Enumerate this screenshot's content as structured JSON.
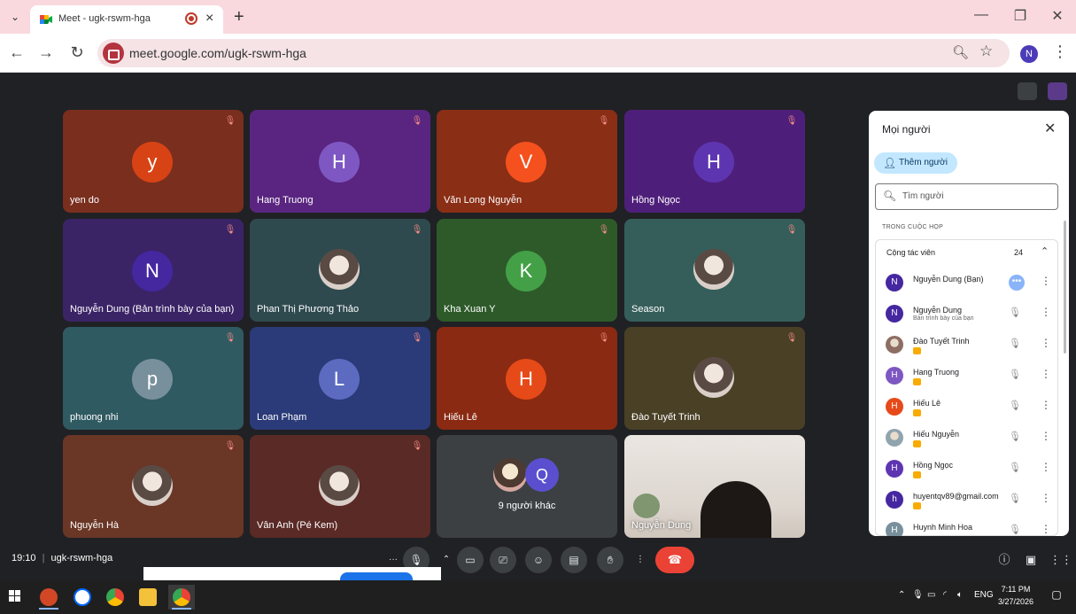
{
  "browser": {
    "tab_title": "Meet - ugk-rswm-hga",
    "new_tab_symbol": "+",
    "url": "meet.google.com/ugk-rswm-hga",
    "profile_initial": "N"
  },
  "tiles": [
    {
      "name": "yen do",
      "initial": "y",
      "avatar_color": "#d84315",
      "bg": "#7a2e1e",
      "photo": false
    },
    {
      "name": "Hang Truong",
      "initial": "H",
      "avatar_color": "#7e57c2",
      "bg": "#5a2580",
      "photo": false
    },
    {
      "name": "Văn Long Nguyễn",
      "initial": "V",
      "avatar_color": "#f4511e",
      "bg": "#8a2e16",
      "photo": false
    },
    {
      "name": "Hồng Ngọc",
      "initial": "H",
      "avatar_color": "#5e35b1",
      "bg": "#4e1f7a",
      "photo": false
    },
    {
      "name": "Nguyễn Dung (Bản trình bày của bạn)",
      "initial": "N",
      "avatar_color": "#4527a0",
      "bg": "#3a2466",
      "photo": false
    },
    {
      "name": "Phan Thị Phương Thảo",
      "initial": "",
      "avatar_color": "",
      "bg": "#2f4a4f",
      "photo": true
    },
    {
      "name": "Kha Xuan Y",
      "initial": "K",
      "avatar_color": "#43a047",
      "bg": "#2e5a2a",
      "photo": false
    },
    {
      "name": "Season",
      "initial": "",
      "avatar_color": "",
      "bg": "#355e5a",
      "photo": true
    },
    {
      "name": "phuong nhi",
      "initial": "p",
      "avatar_color": "#78909c",
      "bg": "#305a62",
      "photo": false
    },
    {
      "name": "Loan Phạm",
      "initial": "L",
      "avatar_color": "#5c6bc0",
      "bg": "#2b3a78",
      "photo": false
    },
    {
      "name": "Hiếu Lê",
      "initial": "H",
      "avatar_color": "#e64a19",
      "bg": "#8a2a12",
      "photo": false
    },
    {
      "name": "Đào Tuyết Trinh",
      "initial": "",
      "avatar_color": "",
      "bg": "#4a4026",
      "photo": true
    },
    {
      "name": "Nguyễn Hà",
      "initial": "",
      "avatar_color": "",
      "bg": "#6a3626",
      "photo": true
    },
    {
      "name": "Vân Anh (Pé Kem)",
      "initial": "",
      "avatar_color": "",
      "bg": "#5a2a26",
      "photo": true
    }
  ],
  "others_tile": {
    "initial": "Q",
    "label": "9 người khác"
  },
  "self_tile": {
    "name": "Nguyễn Dung"
  },
  "panel": {
    "title": "Mọi người",
    "add_label": "Thêm người",
    "search_placeholder": "Tìm người",
    "section_label": "TRONG CUỘC HỌP",
    "group_name": "Cộng tác viên",
    "group_count": "24",
    "members": [
      {
        "name": "Nguyễn Dung (Bạn)",
        "sub": "",
        "initial": "N",
        "color": "#4527a0",
        "photo": false,
        "badge": false,
        "action": "more"
      },
      {
        "name": "Nguyễn Dung",
        "sub": "Bản trình bày của bạn",
        "initial": "N",
        "color": "#4527a0",
        "photo": false,
        "badge": false,
        "action": "mute"
      },
      {
        "name": "Đào Tuyết Trinh",
        "sub": "",
        "initial": "",
        "color": "#8d6e63",
        "photo": true,
        "badge": true,
        "action": "mute"
      },
      {
        "name": "Hang Truong",
        "sub": "",
        "initial": "H",
        "color": "#7e57c2",
        "photo": false,
        "badge": true,
        "action": "mute"
      },
      {
        "name": "Hiếu Lê",
        "sub": "",
        "initial": "H",
        "color": "#e64a19",
        "photo": false,
        "badge": true,
        "action": "mute"
      },
      {
        "name": "Hiếu Nguyễn",
        "sub": "",
        "initial": "",
        "color": "#90a4ae",
        "photo": true,
        "badge": true,
        "action": "mute"
      },
      {
        "name": "Hồng Ngọc",
        "sub": "",
        "initial": "H",
        "color": "#5e35b1",
        "photo": false,
        "badge": true,
        "action": "mute"
      },
      {
        "name": "huyentqv89@gmail.com",
        "sub": "",
        "initial": "h",
        "color": "#4527a0",
        "photo": false,
        "badge": true,
        "action": "mute"
      },
      {
        "name": "Huynh Minh Hoa",
        "sub": "",
        "initial": "H",
        "color": "#78909c",
        "photo": false,
        "badge": false,
        "action": "mute"
      }
    ]
  },
  "callbar": {
    "time": "19:10",
    "meeting_code": "ugk-rswm-hga"
  },
  "taskbar": {
    "language": "ENG",
    "time": "7:11 PM",
    "date": "3/27/2026"
  },
  "colors": {
    "end_call": "#ea4335",
    "accent": "#1a73e8"
  }
}
